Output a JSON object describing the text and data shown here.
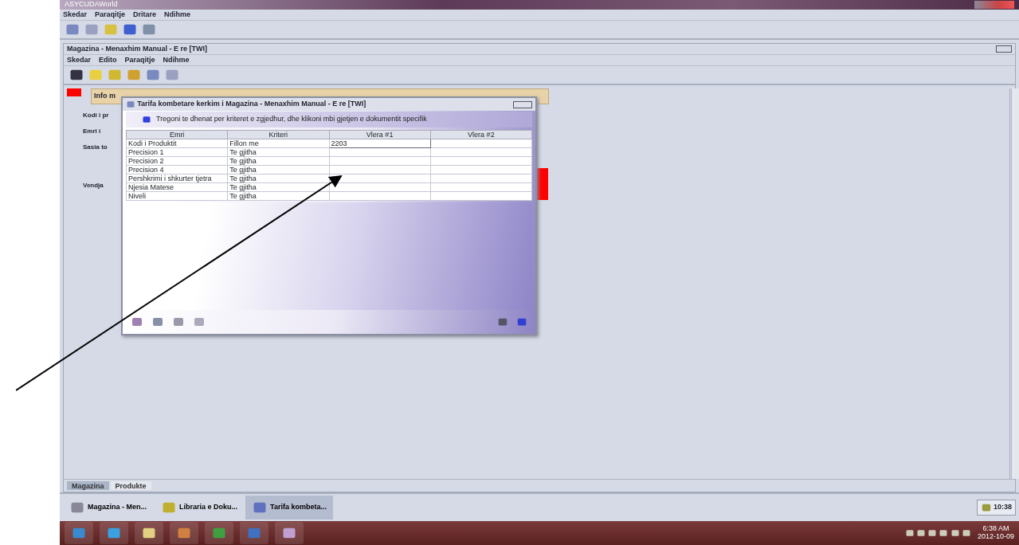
{
  "window": {
    "title": "ASYCUDAWorld"
  },
  "menu": [
    "Skedar",
    "Paraqitje",
    "Dritare",
    "Ndihme"
  ],
  "inner_window": {
    "title": "Magazina - Menaxhim Manual - E re [TWI]",
    "menu": [
      "Skedar",
      "Edito",
      "Paraqitje",
      "Ndihme"
    ]
  },
  "form": {
    "tab": "Info m",
    "labels": [
      "Kodi i pr",
      "Emri i",
      "Sasia to",
      "Vendja"
    ]
  },
  "dialog": {
    "title": "Tarifa kombetare kerkim i Magazina - Menaxhim Manual - E re [TWI]",
    "hint": "Tregoni te dhenat per kriteret e zgjedhur, dhe klikoni mbi gjetjen e dokumentit specifik",
    "columns": [
      "Emri",
      "Kriteri",
      "Vlera #1",
      "Vlera #2"
    ],
    "rows": [
      {
        "name": "Kodi i Produktit",
        "criterion": "Fillon me",
        "value_1": "2203",
        "editing": true
      },
      {
        "name": "Precision 1",
        "criterion": "Te gjitha",
        "editing": false
      },
      {
        "name": "Precision 2",
        "criterion": "Te gjitha",
        "editing": false
      },
      {
        "name": "Precision 4",
        "criterion": "Te gjitha",
        "editing": false
      },
      {
        "name": "Pershkrimi i shkurter tjetra",
        "criterion": "Te gjitha",
        "editing": false
      },
      {
        "name": "Njesia Matese",
        "criterion": "Te gjitha",
        "editing": false
      },
      {
        "name": "Niveli",
        "criterion": "Te gjitha",
        "editing": false
      }
    ]
  },
  "bottom_tabs": [
    {
      "label": "Magazina",
      "selected": true
    },
    {
      "label": "Produkte",
      "selected": false
    }
  ],
  "task_buttons": [
    {
      "label": "Magazina - Men...",
      "selected": false
    },
    {
      "label": "Libraria e Doku...",
      "selected": false
    },
    {
      "label": "Tarifa kombeta...",
      "selected": true
    }
  ],
  "clock": "10:38",
  "system_tray": {
    "time": "6:38 AM",
    "date": "2012-10-09"
  }
}
